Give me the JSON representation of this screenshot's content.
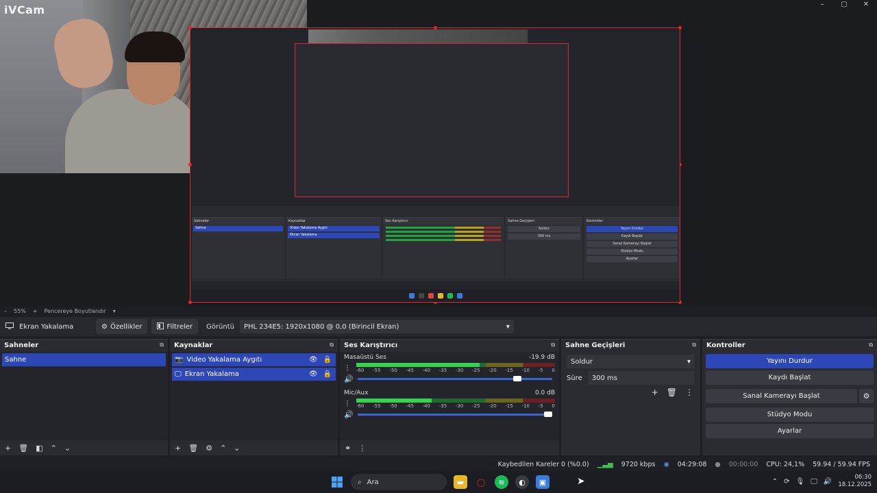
{
  "camera": {
    "logo": "iVCam"
  },
  "window": {
    "minimize_icon": "–",
    "maximize_icon": "▢",
    "close_icon": "✕"
  },
  "zoombar": {
    "minus": "–",
    "zoom": "55%",
    "plus": "+",
    "fit": "Pencereye Boyutlandır",
    "caret": "▾"
  },
  "toolbar": {
    "source": "Ekran Yakalama",
    "properties": "Özellikler",
    "filters": "Filtreler",
    "display_label": "Görüntü",
    "display_value": "PHL 234E5: 1920x1080 @ 0,0 (Birincil Ekran)"
  },
  "scenes": {
    "title": "Sahneler",
    "items": [
      "Sahne"
    ]
  },
  "sources": {
    "title": "Kaynaklar",
    "items": [
      "Video Yakalama Aygıtı",
      "Ekran Yakalama"
    ]
  },
  "mixer": {
    "title": "Ses Karıştırıcı",
    "ticks": [
      "-60",
      "-55",
      "-50",
      "-45",
      "-40",
      "-35",
      "-30",
      "-25",
      "-20",
      "-15",
      "-10",
      "-5",
      "0"
    ],
    "channels": [
      {
        "name": "Masaüstü Ses",
        "db": "-19.9 dB",
        "level": 0.62,
        "volume": 0.84
      },
      {
        "name": "Mic/Aux",
        "db": "0.0 dB",
        "level": 0.38,
        "volume": 1.0
      }
    ]
  },
  "transitions": {
    "title": "Sahne Geçişleri",
    "selected": "Soldur",
    "duration_label": "Süre",
    "duration_value": "300 ms"
  },
  "controls": {
    "title": "Kontroller",
    "buttons": [
      "Yayını Durdur",
      "Kaydı Başlat",
      "Sanal Kamerayı Başlat",
      "Stüdyo Modu",
      "Ayarlar"
    ]
  },
  "status": {
    "dropped": "Kaybedilen Kareler 0 (%0.0)",
    "bitrate": "9720 kbps",
    "stream_time": "04:29:08",
    "rec_time": "00:00:00",
    "cpu": "CPU: 24,1%",
    "fps": "59.94 / 59.94 FPS"
  },
  "taskbar": {
    "search": "Ara",
    "time": "06:30",
    "date": "18.12.2025"
  },
  "colors": {
    "accent": "#2e47b6",
    "record_red": "#e0262b",
    "meter_green": "#36d24f"
  }
}
